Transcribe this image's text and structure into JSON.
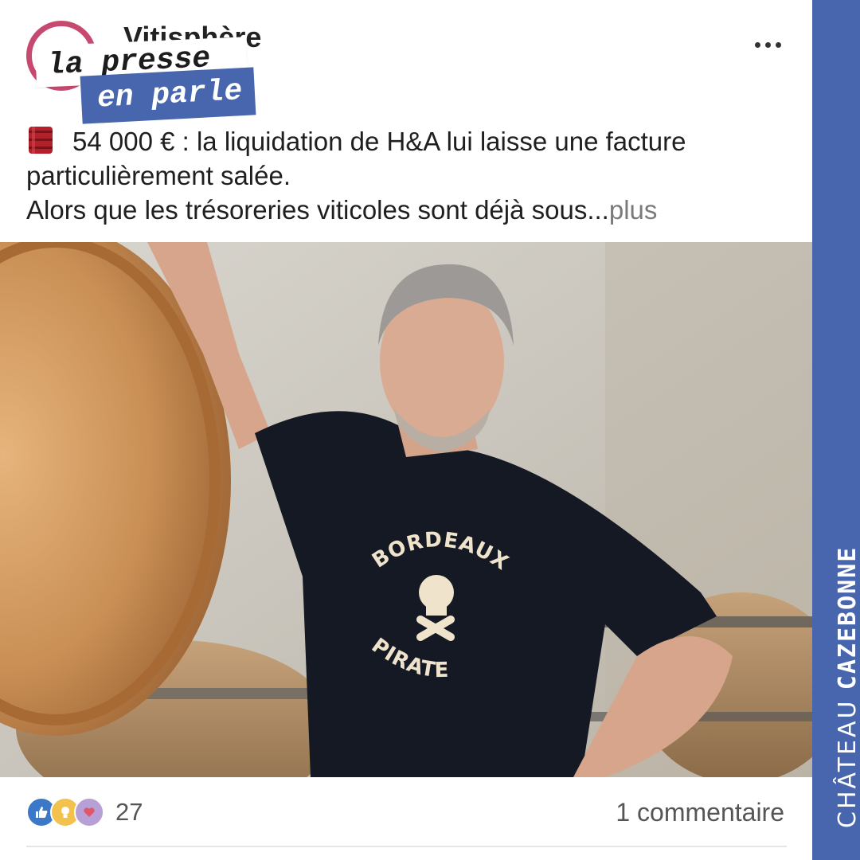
{
  "header": {
    "page_name": "Vitisphère",
    "more_menu_icon": "ellipsis-icon"
  },
  "badge": {
    "line1": "la presse",
    "line2": "en parle"
  },
  "post": {
    "emoji_icon": "barrel-icon",
    "line1": "54 000 € : la liquidation de H&A lui laisse une facture particulièrement salée.",
    "line2": "Alors que les trésoreries viticoles sont déjà sous...",
    "more_label": "plus"
  },
  "photo": {
    "shirt_text_top": "BORDEAUX",
    "shirt_text_bottom": "PIRATE"
  },
  "footer": {
    "reaction_icons": [
      "like-icon",
      "idea-icon",
      "love-icon"
    ],
    "reaction_count": "27",
    "comments_label": "1 commentaire"
  },
  "brand": {
    "thin": "CHÂTEAU",
    "bold": "CAZEBONNE",
    "color": "#4766ad"
  },
  "colors": {
    "avatar_ring": "#c64a6f",
    "band": "#4766ad"
  }
}
